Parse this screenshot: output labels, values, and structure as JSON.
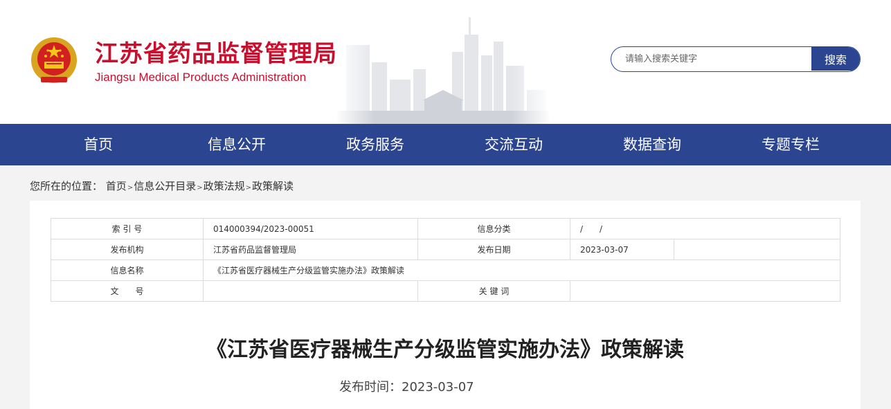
{
  "header": {
    "title_cn": "江苏省药品监督管理局",
    "title_en": "Jiangsu Medical Products Administration",
    "emblem_icon": "national-emblem-icon"
  },
  "search": {
    "placeholder": "请输入搜索关键字",
    "button_label": "搜索"
  },
  "nav": {
    "items": [
      {
        "label": "首页"
      },
      {
        "label": "信息公开"
      },
      {
        "label": "政务服务"
      },
      {
        "label": "交流互动"
      },
      {
        "label": "数据查询"
      },
      {
        "label": "专题专栏"
      }
    ]
  },
  "breadcrumb": {
    "prefix": "您所在的位置：",
    "items": [
      "首页",
      "信息公开目录",
      "政策法规",
      "政策解读"
    ],
    "separator": ">"
  },
  "info": {
    "index_label": "索 引 号",
    "index_value": "014000394/2023-00051",
    "category_label": "信息分类",
    "category_value": "/　　/",
    "publisher_label": "发布机构",
    "publisher_value": "江苏省药品监督管理局",
    "date_label": "发布日期",
    "date_value": "2023-03-07",
    "name_label": "信息名称",
    "name_value": "《江苏省医疗器械生产分级监管实施办法》政策解读",
    "docno_label": "文　　号",
    "docno_value": "",
    "keywords_label": "关 键 词",
    "keywords_value": ""
  },
  "article": {
    "title": "《江苏省医疗器械生产分级监管实施办法》政策解读",
    "publish_time": "发布时间：2023-03-07"
  },
  "colors": {
    "brand_red": "#c8102e",
    "nav_blue": "#2c4591",
    "page_bg": "#f3f3f3"
  }
}
